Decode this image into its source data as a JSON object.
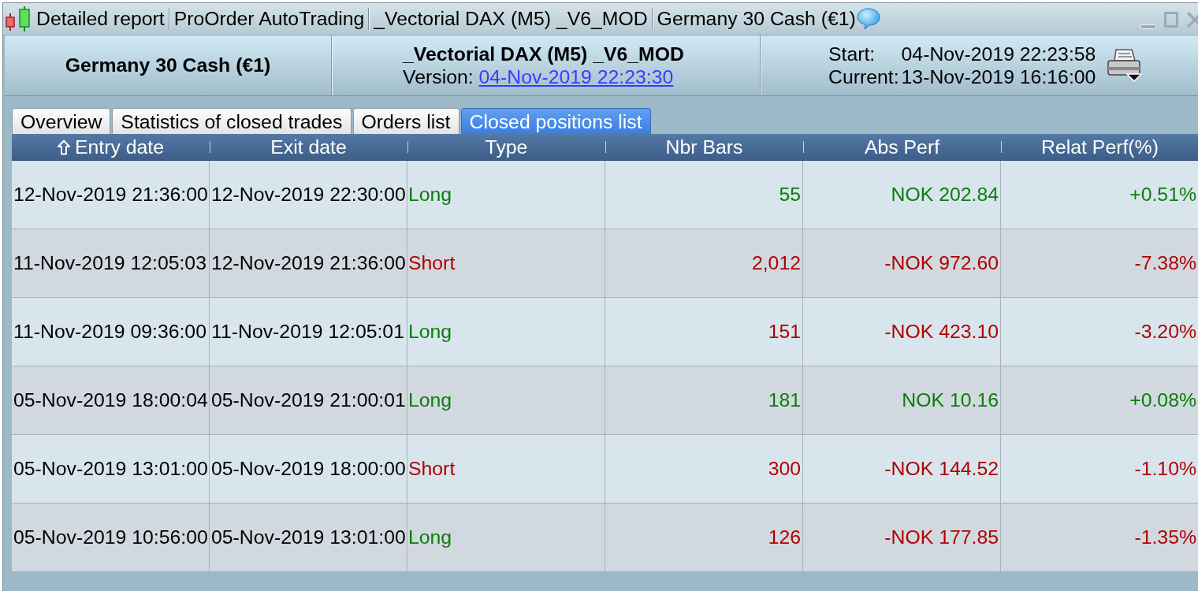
{
  "window": {
    "title_segments": [
      "Detailed report",
      "ProOrder AutoTrading",
      "_Vectorial DAX (M5) _V6_MOD",
      "Germany 30 Cash (€1)"
    ]
  },
  "header": {
    "instrument": "Germany 30 Cash (€1)",
    "system": {
      "name": "_Vectorial DAX (M5) _V6_MOD",
      "version_label": "Version:",
      "version_date": "04-Nov-2019 22:23:30"
    },
    "dates": [
      {
        "label": "Start:",
        "value": "04-Nov-2019 22:23:58"
      },
      {
        "label": "Current:",
        "value": "13-Nov-2019 16:16:00"
      }
    ]
  },
  "tabs": [
    {
      "label": "Overview",
      "selected": false
    },
    {
      "label": "Statistics of closed trades",
      "selected": false
    },
    {
      "label": "Orders list",
      "selected": false
    },
    {
      "label": "Closed positions list",
      "selected": true
    }
  ],
  "table": {
    "columns": [
      {
        "label": "Entry date",
        "sorted": true
      },
      {
        "label": "Exit date",
        "sorted": false
      },
      {
        "label": "Type",
        "sorted": false
      },
      {
        "label": "Nbr Bars",
        "sorted": false
      },
      {
        "label": "Abs Perf",
        "sorted": false
      },
      {
        "label": "Relat Perf(%)",
        "sorted": false
      }
    ],
    "rows": [
      {
        "kind": "long",
        "profitable": true,
        "cells": [
          "12-Nov-2019 21:36:00",
          "12-Nov-2019 22:30:00",
          "Long",
          "55",
          "NOK 202.84",
          "+0.51%"
        ]
      },
      {
        "kind": "short",
        "profitable": false,
        "cells": [
          "11-Nov-2019 12:05:03",
          "12-Nov-2019 21:36:00",
          "Short",
          "2,012",
          "-NOK 972.60",
          "-7.38%"
        ]
      },
      {
        "kind": "long",
        "profitable": false,
        "cells": [
          "11-Nov-2019 09:36:00",
          "11-Nov-2019 12:05:01",
          "Long",
          "151",
          "-NOK 423.10",
          "-3.20%"
        ]
      },
      {
        "kind": "long",
        "profitable": true,
        "cells": [
          "05-Nov-2019 18:00:04",
          "05-Nov-2019 21:00:01",
          "Long",
          "181",
          "NOK 10.16",
          "+0.08%"
        ]
      },
      {
        "kind": "short",
        "profitable": false,
        "cells": [
          "05-Nov-2019 13:01:00",
          "05-Nov-2019 18:00:00",
          "Short",
          "300",
          "-NOK 144.52",
          "-1.10%"
        ]
      },
      {
        "kind": "long",
        "profitable": false,
        "cells": [
          "05-Nov-2019 10:56:00",
          "05-Nov-2019 13:01:00",
          "Long",
          "126",
          "-NOK 177.85",
          "-1.35%"
        ]
      }
    ]
  }
}
